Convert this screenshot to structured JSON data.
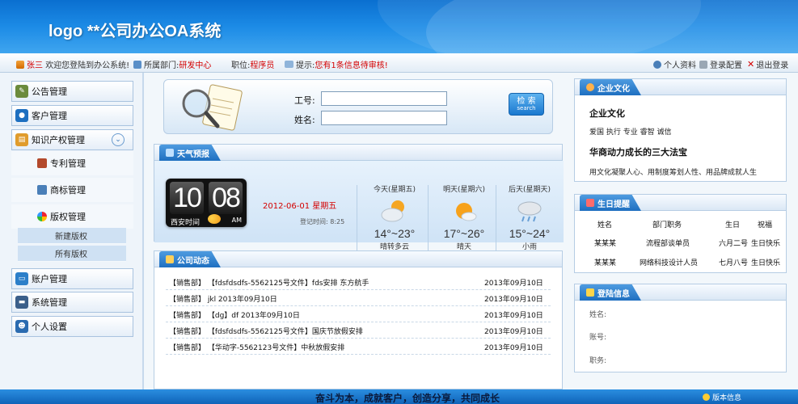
{
  "header": {
    "title": "logo  **公司办公OA系统"
  },
  "topbar": {
    "user": "张三",
    "welcome": "欢迎您登陆到办公系统!",
    "dept_label": "所属部门:",
    "dept_value": "研发中心",
    "post_label": "职位:",
    "post_value": "程序员",
    "notice_label": "提示:",
    "notice_value": "您有1条信息待审核!",
    "profile": "个人资料",
    "login_config": "登录配置",
    "logout": "退出登录"
  },
  "nav": {
    "notice": "公告管理",
    "customer": "客户管理",
    "ip": "知识产权管理",
    "patent": "专利管理",
    "trademark": "商标管理",
    "copyright": "版权管理",
    "copyright_new": "新建版权",
    "copyright_all": "所有版权",
    "account": "账户管理",
    "system": "系统管理",
    "personal": "个人设置"
  },
  "search": {
    "id_label": "工号:",
    "name_label": "姓名:",
    "btn_cn": "检 索",
    "btn_en": "search"
  },
  "weather": {
    "title": "天气预报",
    "hour": "10",
    "minute": "08",
    "city": "西安时间",
    "ampm": "AM",
    "date": "2012-06-01 星期五",
    "login_time": "登记时间: 8:25",
    "days": [
      {
        "label": "今天(星期五)",
        "temp": "14°~23°",
        "cond": "晴转多云"
      },
      {
        "label": "明天(星期六)",
        "temp": "17°~26°",
        "cond": "晴天"
      },
      {
        "label": "后天(星期天)",
        "temp": "15°~24°",
        "cond": "小雨"
      }
    ]
  },
  "news": {
    "title": "公司动态",
    "items": [
      {
        "text": "【销售部】  【fdsfdsdfs-5562125号文件】fds安排 东方航手",
        "date": "2013年09月10日"
      },
      {
        "text": "【销售部】  jkl  2013年09月10日",
        "date": "2013年09月10日"
      },
      {
        "text": "【销售部】  【dg】df  2013年09月10日",
        "date": "2013年09月10日"
      },
      {
        "text": "【销售部】  【fdsfdsdfs-5562125号文件】国庆节放假安排",
        "date": "2013年09月10日"
      },
      {
        "text": "【销售部】  【华动字-5562123号文件】中秋放假安排",
        "date": "2013年09月10日"
      }
    ]
  },
  "culture": {
    "title": "企业文化",
    "h1": "企业文化",
    "p1": "爱国 执行 专业 睿智 诚信",
    "h2": "华商动力成长的三大法宝",
    "p2": "用文化凝聚人心、用制度筹划人性、用品牌成就人生"
  },
  "birthday": {
    "title": "生日提醒",
    "headers": [
      "姓名",
      "部门职务",
      "生日",
      "祝福"
    ],
    "rows": [
      [
        "某某某",
        "流程部谈单员",
        "六月二号",
        "生日快乐"
      ],
      [
        "某某某",
        "网络科技设计人员",
        "七月八号",
        "生日快乐"
      ]
    ]
  },
  "logininfo": {
    "title": "登陆信息",
    "name": "姓名:",
    "account": "账号:",
    "post": "职务:"
  },
  "footer": {
    "slogan": "奋斗为本，成就客户，创造分享，共同成长",
    "version": "版本信息"
  },
  "colors": {
    "accent": "#1e6fc0",
    "alert": "#d40000"
  }
}
